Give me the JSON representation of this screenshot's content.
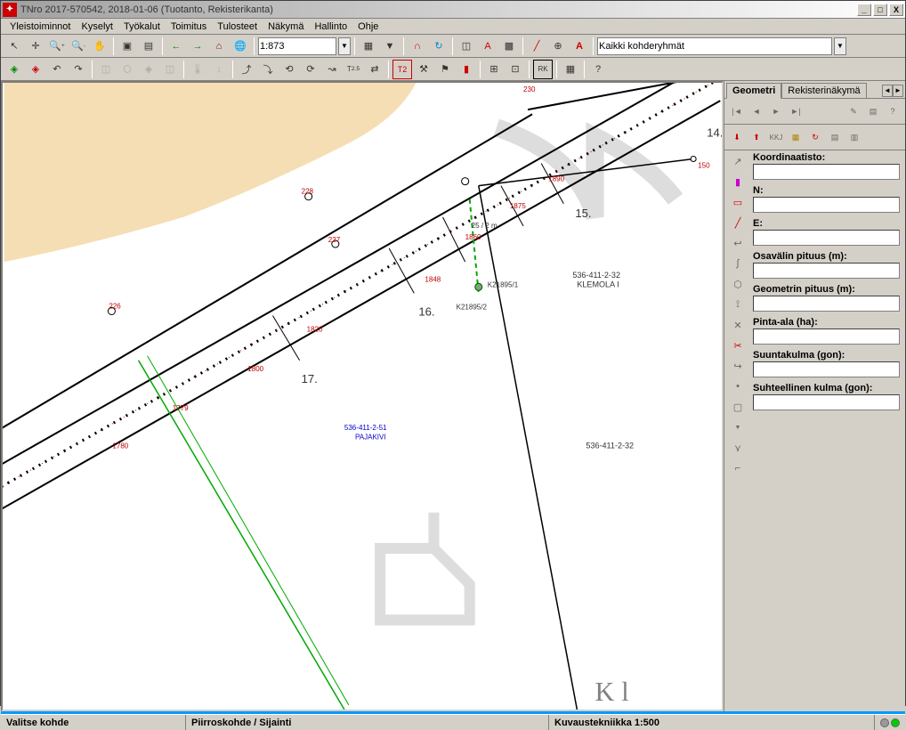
{
  "window": {
    "title": "TNro 2017-570542, 2018-01-06 (Tuotanto, Rekisterikanta)"
  },
  "menu": [
    "Yleistoiminnot",
    "Kyselyt",
    "Työkalut",
    "Toimitus",
    "Tulosteet",
    "Näkymä",
    "Hallinto",
    "Ohje"
  ],
  "toolbar": {
    "scale": "1:873",
    "layer_filter": "Kaikki kohderyhmät"
  },
  "tabs": {
    "active": "Geometri",
    "other": "Rekisterinäkymä"
  },
  "form": {
    "koordinaatisto": {
      "label": "Koordinaatisto:",
      "value": ""
    },
    "n": {
      "label": "N:",
      "value": ""
    },
    "e": {
      "label": "E:",
      "value": ""
    },
    "osavalin": {
      "label": "Osavälin pituus (m):",
      "value": ""
    },
    "geometrin": {
      "label": "Geometrin pituus (m):",
      "value": ""
    },
    "pinta_ala": {
      "label": "Pinta-ala (ha):",
      "value": ""
    },
    "suuntakulma": {
      "label": "Suuntakulma (gon):",
      "value": ""
    },
    "suhteellinen": {
      "label": "Suhteellinen kulma (gon):",
      "value": ""
    }
  },
  "map": {
    "parcels": {
      "klemola": {
        "id": "536-411-2-32",
        "name": "KLEMOLA I"
      },
      "pajakivi": {
        "id": "536-411-2-51",
        "name": "PAJAKIVI"
      },
      "south": {
        "id": "536-411-2-32"
      }
    },
    "points": {
      "k1": "K21895/1",
      "k2": "K21895/2",
      "m25": "25 / 2 m"
    },
    "markers": [
      "226",
      "227",
      "228",
      "230",
      "1780",
      "1779",
      "1800",
      "1820",
      "1848",
      "1860",
      "1875",
      "1890",
      "150"
    ],
    "labels": [
      "14.",
      "15.",
      "16.",
      "17."
    ]
  },
  "statusbar": {
    "left": "Valitse kohde",
    "center": "Piirroskohde / Sijainti",
    "right": "Kuvaustekniikka 1:500"
  }
}
